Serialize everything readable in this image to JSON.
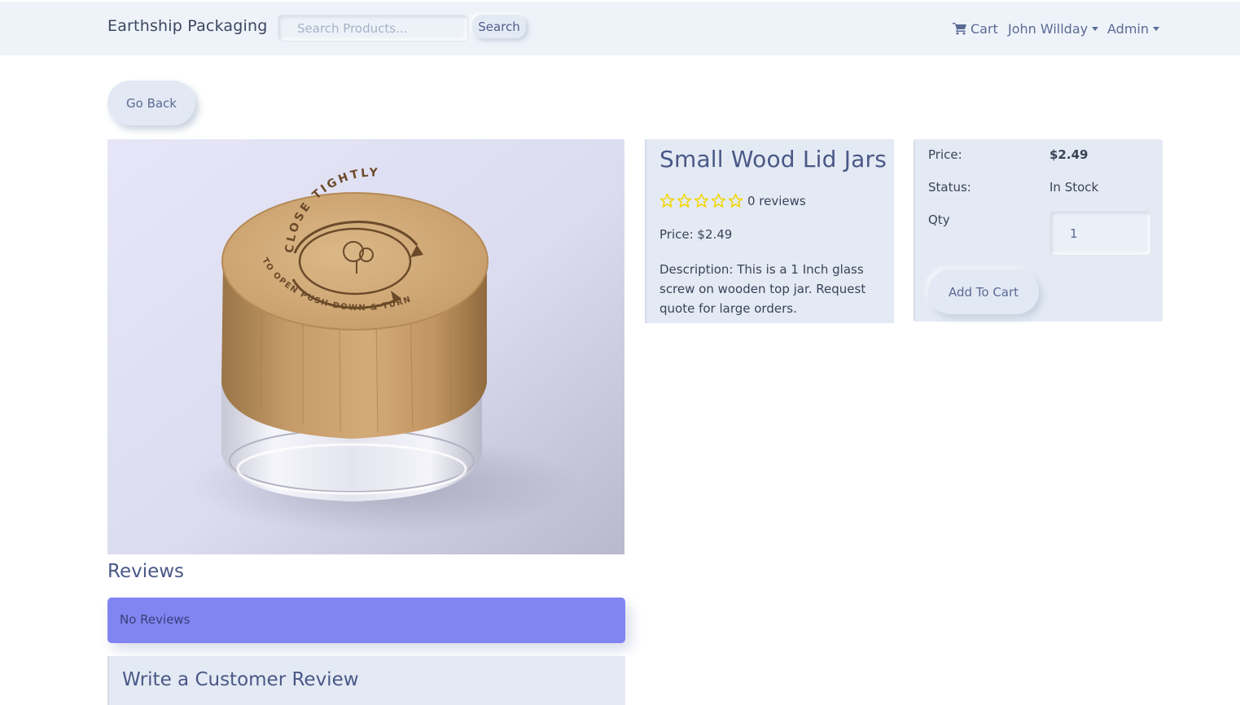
{
  "navbar": {
    "brand": "Earthship Packaging",
    "search_placeholder": "Search Products...",
    "search_button": "Search",
    "cart_label": "Cart",
    "user_label": "John Willday",
    "admin_label": "Admin"
  },
  "go_back_label": "Go Back",
  "product": {
    "title": "Small Wood Lid Jars",
    "rating_stars": 0,
    "rating_max": 5,
    "reviews_count_text": "0 reviews",
    "price_line": "Price: $2.49",
    "description_line": "Description: This is a 1 Inch glass screw on wooden top jar. Request quote for large orders.",
    "lid_text_top": "CLOSE TIGHTLY",
    "lid_text_bottom": "TO OPEN PUSH DOWN & TURN"
  },
  "purchase": {
    "price_label": "Price:",
    "price_value": "$2.49",
    "status_label": "Status:",
    "status_value": "In Stock",
    "qty_label": "Qty",
    "qty_value": "1",
    "add_to_cart": "Add To Cart"
  },
  "reviews": {
    "heading": "Reviews",
    "empty_message": "No Reviews",
    "write_heading": "Write a Customer Review"
  },
  "colors": {
    "navbar_bg": "#eef3f9",
    "card_bg": "#e4eaf4",
    "accent_text": "#4a5887",
    "star": "#f2d600",
    "alert_bg": "#8085f1"
  },
  "icons": [
    "cart-icon",
    "star-outline-icon",
    "caret-down-icon"
  ]
}
